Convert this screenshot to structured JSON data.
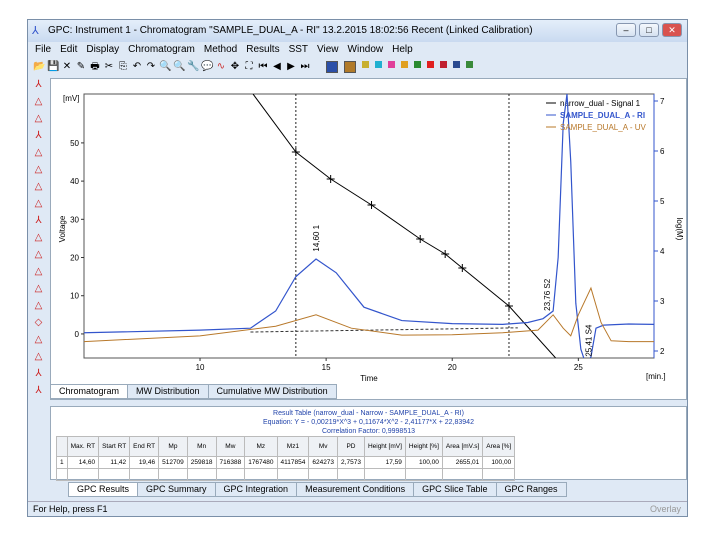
{
  "window": {
    "title": "GPC: Instrument 1 - Chromatogram \"SAMPLE_DUAL_A - RI\" 13.2.2015 18:02:56 Recent (Linked Calibration)"
  },
  "menu": [
    "File",
    "Edit",
    "Display",
    "Chromatogram",
    "Method",
    "Results",
    "SST",
    "View",
    "Window",
    "Help"
  ],
  "toolbar_colors": [
    "#2b4fa8",
    "#b07a2a",
    "#c8b030",
    "#20b0d0",
    "#e0409a",
    "#e0a020",
    "#2a8a30",
    "#e02020",
    "#c02030",
    "#2a4a90",
    "#3a8a3a"
  ],
  "chart_data": {
    "type": "line",
    "xlabel": "Time",
    "ylabel": "Voltage",
    "yunit": "[mV]",
    "y2label": "log(M)",
    "xunit": "[min.]",
    "xlim": [
      5.4,
      28
    ],
    "ylim": [
      -6.3,
      62.8
    ],
    "y2lim": [
      1.86,
      7.14
    ],
    "xticks": [
      10,
      15,
      20,
      25
    ],
    "yticks": [
      0,
      10,
      20,
      30,
      40,
      50
    ],
    "y2ticks": [
      2,
      3,
      4,
      5,
      6,
      7
    ],
    "series": [
      {
        "name": "narrow_dual - Signal 1",
        "axis": "right",
        "color": "#000000",
        "x": [
          12.1,
          13.8,
          15.18,
          16.8,
          18.73,
          19.72,
          20.4,
          22.25,
          24.1
        ],
        "y": [
          7.14,
          5.98,
          5.44,
          4.92,
          4.24,
          3.94,
          3.66,
          2.9,
          1.86
        ],
        "markers": [
          13.8,
          15.18,
          16.8,
          18.73,
          19.72,
          20.4,
          22.25
        ]
      },
      {
        "name": "SAMPLE_DUAL_A - RI",
        "axis": "left",
        "color": "#3355cc",
        "x": [
          5.4,
          10,
          12,
          13,
          13.8,
          14.6,
          15.4,
          16.5,
          18,
          20,
          22,
          23,
          23.6,
          24,
          24.2,
          24.4,
          24.55,
          24.7,
          24.9,
          25.1,
          25.3,
          25.5,
          25.7,
          26,
          27,
          28
        ],
        "y": [
          0.3,
          1,
          1.5,
          6,
          15,
          19.6,
          16,
          7,
          3.5,
          2.7,
          2.5,
          3,
          4,
          6,
          20,
          55,
          62.8,
          45,
          8,
          -4,
          -8,
          -6,
          1.5,
          2.3,
          2.6,
          2.5
        ],
        "peak_labels": [
          "14,60  1",
          "23,76  S2",
          "25,41  S4"
        ]
      },
      {
        "name": "SAMPLE_DUAL_A - UV",
        "axis": "left",
        "color": "#b8782a",
        "x": [
          5.4,
          10,
          13,
          14.6,
          16,
          18,
          20,
          22,
          23.4,
          24,
          24.4,
          24.7,
          25,
          25.5,
          25.9,
          26.3,
          27,
          28
        ],
        "y": [
          -2,
          -0.5,
          2,
          5,
          1.5,
          -0.3,
          -0.2,
          0.3,
          1,
          5,
          1.5,
          -0.5,
          5,
          12,
          3,
          -1.8,
          -2,
          -2
        ]
      }
    ],
    "dotted_lines": [
      13.8,
      22.25
    ],
    "legend": "top-right"
  },
  "chart_tabs": [
    "Chromatogram",
    "MW Distribution",
    "Cumulative MW Distribution"
  ],
  "results": {
    "title": "Result Table (narrow_dual - Narrow - SAMPLE_DUAL_A - RI)",
    "equation": "Equation: Y =  - 0,00219*X^3 + 0,11674*X^2 - 2,41177*X + 22,83942",
    "correlation": "Correlation Factor: 0,9998513",
    "columns": [
      "Max. RT",
      "Start RT",
      "End RT",
      "Mp",
      "Mn",
      "Mw",
      "Mz",
      "Mz1",
      "Mv",
      "PD",
      "Height [mV]",
      "Height [%]",
      "Area [mV.s]",
      "Area [%]"
    ],
    "rows": [
      {
        "index": "1",
        "cells": [
          "14,60",
          "11,42",
          "19,46",
          "512709",
          "259818",
          "716388",
          "1767480",
          "4117854",
          "624273",
          "2,7573",
          "17,59",
          "100,00",
          "2655,01",
          "100,00"
        ]
      }
    ]
  },
  "result_tabs": [
    "GPC Results",
    "GPC Summary",
    "GPC Integration",
    "Measurement Conditions",
    "GPC Slice Table",
    "GPC Ranges"
  ],
  "status": {
    "text": "For Help, press F1",
    "overlay": "Overlay"
  }
}
